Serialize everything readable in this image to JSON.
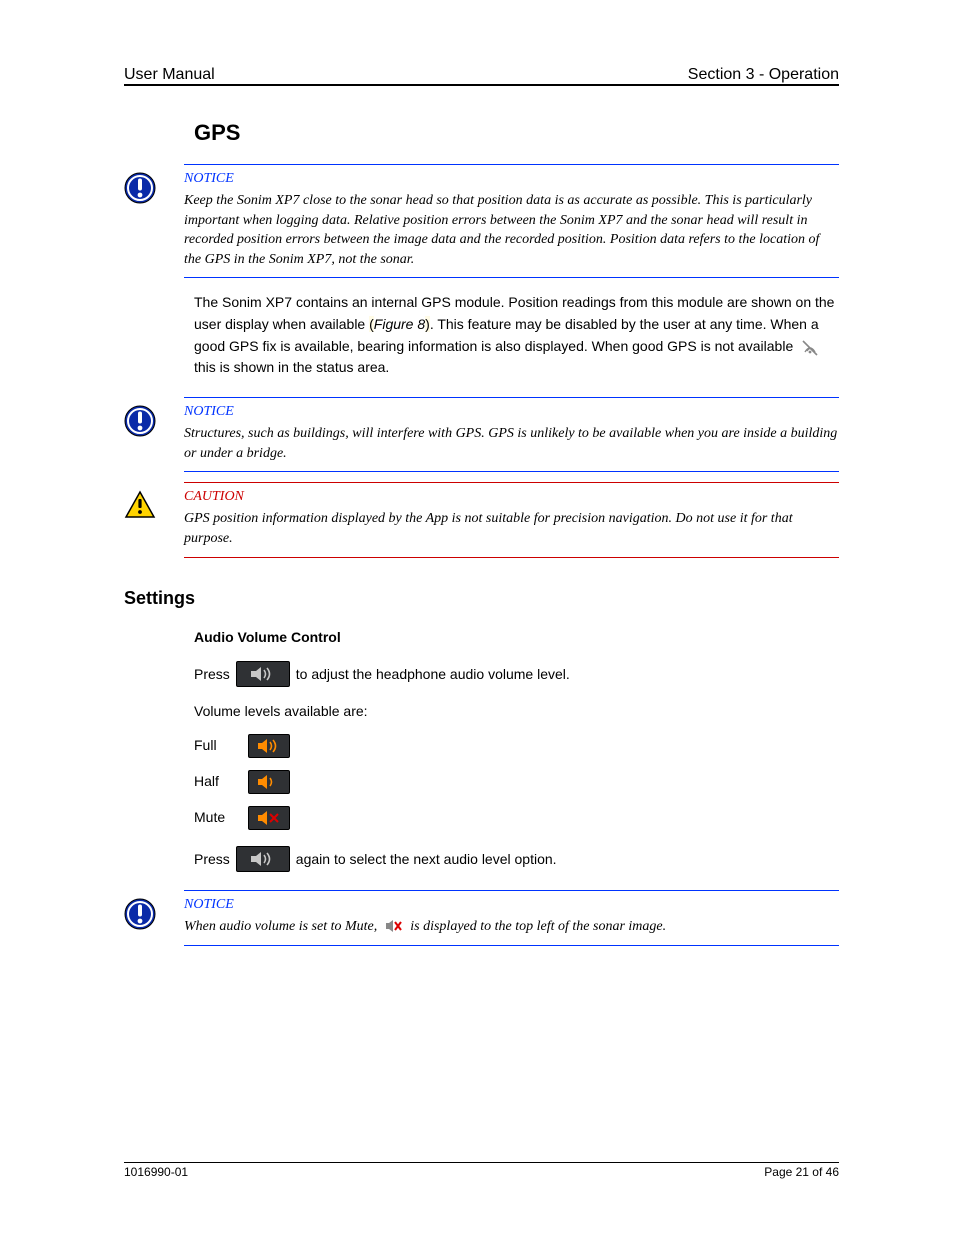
{
  "header": {
    "left": "User Manual",
    "right": "Section 3 - Operation"
  },
  "section_title": "GPS",
  "notice1": {
    "label": "NOTICE",
    "text": "Keep the Sonim XP7 close to the sonar head so that position data is as accurate as possible. This is particularly important when logging data. Relative position errors between the Sonim XP7 and the sonar head will result in recorded position errors between the image data and the recorded position. Position data refers to the location of the GPS in the Sonim XP7, not the sonar."
  },
  "gps_body": {
    "para1_a": "The Sonim XP7 contains an internal GPS module. Position readings from this module are shown on the user display when available ",
    "para1_b": ". This feature may be disabled by the user at any time. When a good GPS fix is available, bearing information is also displayed. When good GPS is not available ",
    "para1_c": " this is shown in the status area."
  },
  "notice2": {
    "label": "NOTICE",
    "text": "Structures, such as buildings, will interfere with GPS. GPS is unlikely to be available when you are inside a building or under a bridge."
  },
  "caution1": {
    "label": "CAUTION",
    "text": "GPS position information displayed by the App is not suitable for precision navigation. Do not use it for that purpose."
  },
  "settings": {
    "heading": "Settings",
    "volume": {
      "subheading": "Audio Volume Control",
      "intro_a": "Press ",
      "intro_b": " to adjust the headphone audio volume level.",
      "levels_intro": "Volume levels available are:",
      "items": [
        {
          "label": "Full"
        },
        {
          "label": "Half"
        },
        {
          "label": "Mute"
        }
      ],
      "outro_a": "Press ",
      "outro_b": " again to select the next audio level option."
    }
  },
  "notice3": {
    "label": "NOTICE",
    "text_a": "When audio volume is set to Mute, ",
    "text_b": " is displayed to the top left of the sonar image."
  },
  "footer": {
    "left": "1016990-01",
    "right": "Page 21 of 46"
  }
}
